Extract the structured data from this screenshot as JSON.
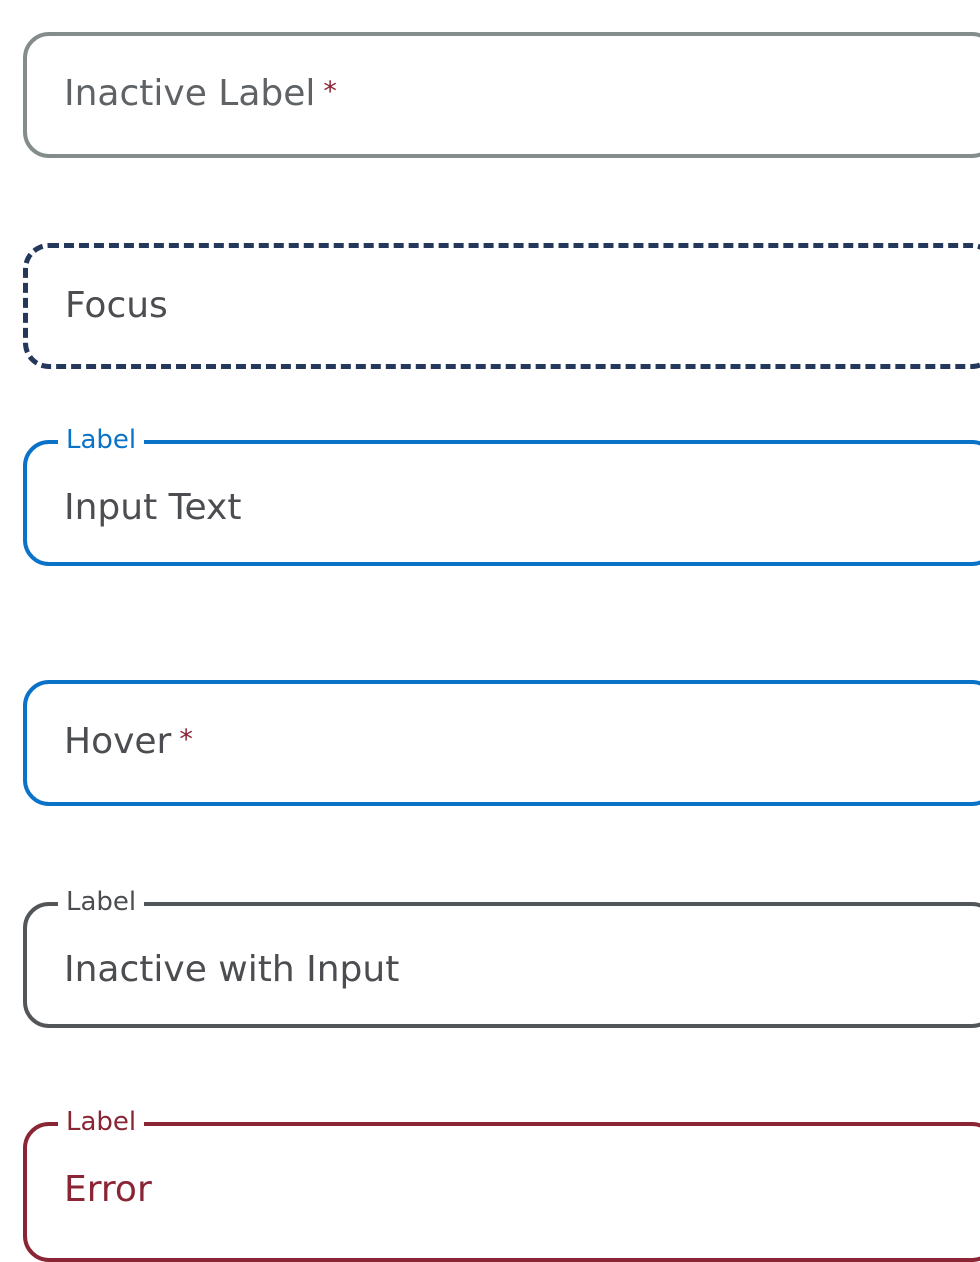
{
  "fields": {
    "inactive": {
      "value": "Inactive Label",
      "required_marker": "*"
    },
    "focus": {
      "value": "Focus"
    },
    "filled_active": {
      "label": "Label",
      "value": "Input Text"
    },
    "hover": {
      "value": "Hover",
      "required_marker": "*"
    },
    "inactive_with_input": {
      "label": "Label",
      "value": "Inactive with Input"
    },
    "error": {
      "label": "Label",
      "value": "Error"
    }
  },
  "colors": {
    "inactive_border": "#858c8c",
    "focus_border": "#23385a",
    "active_blue": "#0a73c8",
    "inactive_with_input_border": "#535659",
    "error_red": "#8a2535",
    "text_dark": "#4b4d50"
  }
}
